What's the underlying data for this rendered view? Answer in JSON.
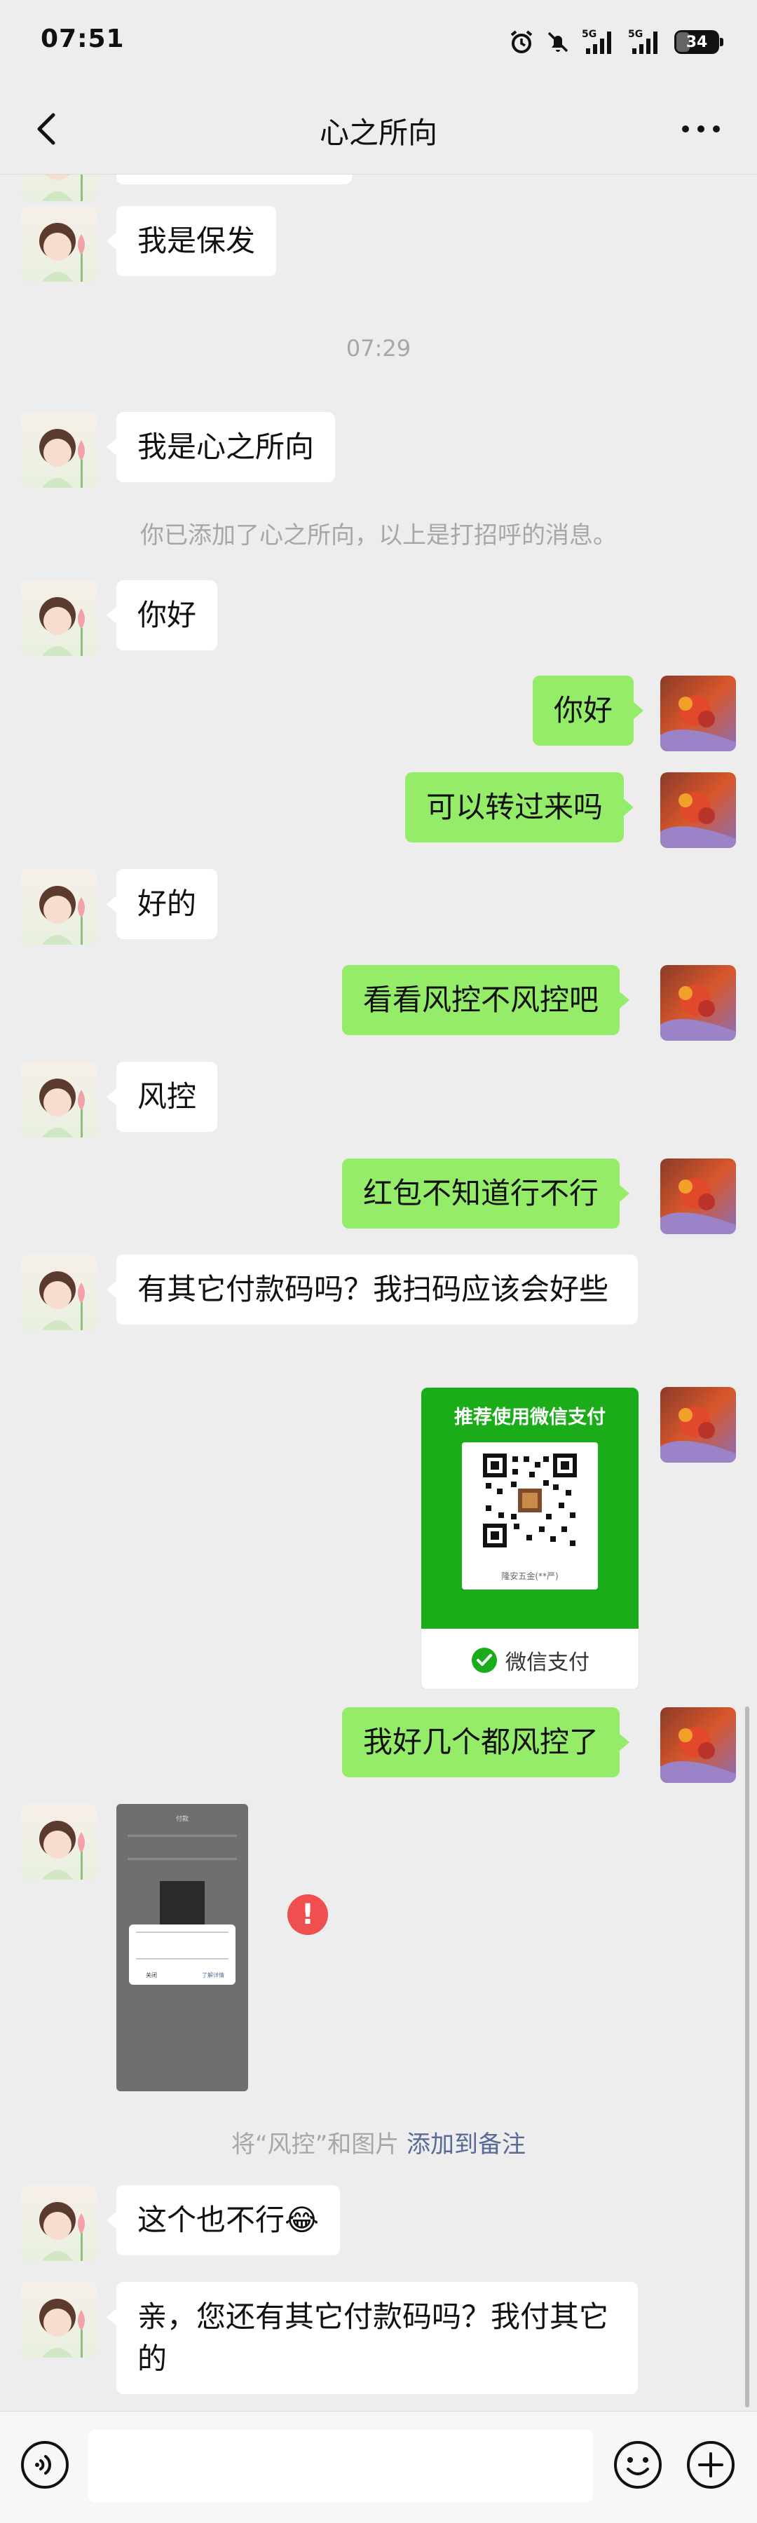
{
  "status_bar": {
    "time": "07:51",
    "network_1": "5G",
    "network_2": "5G",
    "battery": "34"
  },
  "header": {
    "title": "心之所向",
    "back_icon": "chevron-left-icon",
    "more_icon": "more-horizontal-icon"
  },
  "messages": [
    {
      "side": "in",
      "type": "text",
      "text": "我是保发"
    },
    {
      "type": "time",
      "text": "07:29"
    },
    {
      "side": "in",
      "type": "text",
      "text": "我是心之所向"
    },
    {
      "type": "system",
      "text": "你已添加了心之所向，以上是打招呼的消息。"
    },
    {
      "side": "in",
      "type": "text",
      "text": "你好"
    },
    {
      "side": "out",
      "type": "text",
      "text": "你好"
    },
    {
      "side": "out",
      "type": "text",
      "text": "可以转过来吗"
    },
    {
      "side": "in",
      "type": "text",
      "text": "好的"
    },
    {
      "side": "out",
      "type": "text",
      "text": "看看风控不风控吧"
    },
    {
      "side": "in",
      "type": "text",
      "text": "风控"
    },
    {
      "side": "out",
      "type": "text",
      "text": "红包不知道行不行"
    },
    {
      "side": "in",
      "type": "text",
      "text": "有其它付款码吗？我扫码应该会好些"
    },
    {
      "side": "out",
      "type": "paycard",
      "heading": "推荐使用微信支付",
      "merchant": "隆安五金(**严)",
      "footer": "微信支付"
    },
    {
      "side": "out",
      "type": "text",
      "text": "我好几个都风控了",
      "error": true,
      "error_mark": "!"
    },
    {
      "side": "in",
      "type": "image"
    },
    {
      "type": "system",
      "text": "将“风控”和图片",
      "link": "添加到备注"
    },
    {
      "side": "in",
      "type": "text",
      "text": "这个也不行😂"
    },
    {
      "side": "in",
      "type": "text",
      "text": "亲，您还有其它付款码吗？我付其它的"
    }
  ],
  "screenshot_thumb": {
    "title": "付款",
    "dialog_cancel": "关闭",
    "dialog_confirm": "了解详情"
  },
  "input_bar": {
    "placeholder": "",
    "voice_icon": "voice-icon",
    "emoji_icon": "emoji-icon",
    "plus_icon": "plus-icon"
  },
  "colors": {
    "background": "#ededed",
    "bubble_out": "#95ec69",
    "bubble_in": "#ffffff",
    "pay_green": "#1aad19",
    "link": "#576b95",
    "error": "#f04f4f"
  }
}
